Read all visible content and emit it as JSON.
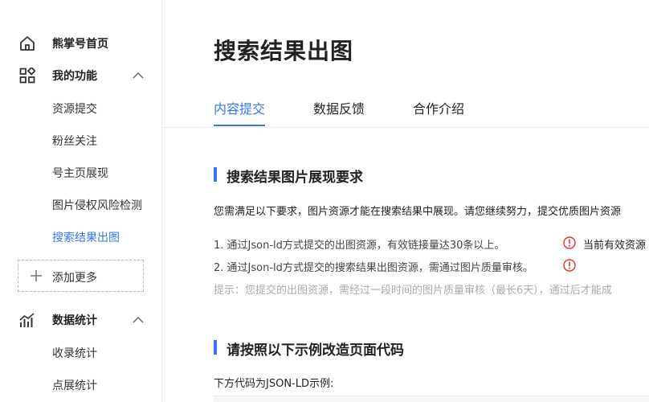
{
  "sidebar": {
    "home": {
      "label": "熊掌号首页",
      "icon": "home-icon"
    },
    "features": {
      "label": "我的功能",
      "icon": "apps-grid-icon",
      "items": [
        "资源提交",
        "粉丝关注",
        "号主页展现",
        "图片侵权风险检测",
        "搜索结果出图"
      ],
      "active_index": 4
    },
    "add_more": "添加更多",
    "stats": {
      "label": "数据统计",
      "icon": "stats-chart-icon",
      "items": [
        "收录统计",
        "点展统计"
      ]
    }
  },
  "main": {
    "title": "搜索结果出图",
    "tabs": [
      {
        "label": "内容提交",
        "active": true
      },
      {
        "label": "数据反馈",
        "active": false
      },
      {
        "label": "合作介绍",
        "active": false
      }
    ],
    "section1": {
      "title": "搜索结果图片展现要求",
      "intro": "您需满足以下要求，图片资源才能在搜索结果中展现。请您继续努力，提交优质图片资源",
      "requirements": [
        {
          "text": "1. 通过Json-ld方式提交的出图资源，有效链接量达30条以上。",
          "status_text": "当前有效资源"
        },
        {
          "text": "2. 通过Json-ld方式提交的搜索结果出图资源，需通过图片质量审核。",
          "status_text": ""
        }
      ],
      "hint": "提示：您提交的出图资源，需经过一段时间的图片质量审核（最长6天），通过后才能成"
    },
    "section2": {
      "title": "请按照以下示例改造页面代码",
      "intro": "下方代码为JSON-LD示例:"
    }
  },
  "colors": {
    "accent": "#3874f6",
    "warning": "#e0322c",
    "hint": "#aaaaaa"
  }
}
